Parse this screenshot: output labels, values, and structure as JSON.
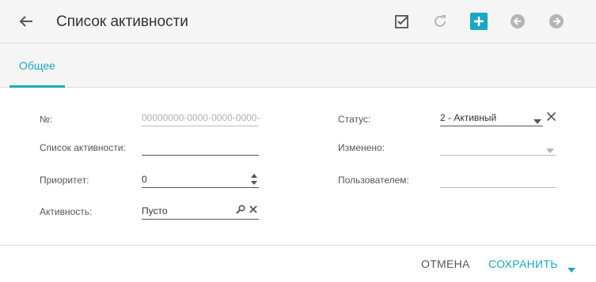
{
  "header": {
    "title": "Список активности"
  },
  "tabs": [
    {
      "label": "Общее"
    }
  ],
  "form": {
    "number": {
      "label": "№:",
      "placeholder": "00000000-0000-0000-0000-"
    },
    "activity_list": {
      "label": "Список активности:",
      "value": ""
    },
    "priority": {
      "label": "Приоритет:",
      "value": "0"
    },
    "activity": {
      "label": "Активность:",
      "value": "Пусто"
    },
    "status": {
      "label": "Статус:",
      "value": "2 - Активный"
    },
    "changed": {
      "label": "Изменено:",
      "value": ""
    },
    "by_user": {
      "label": "Пользователем:",
      "value": ""
    }
  },
  "footer": {
    "cancel_label": "ОТМЕНА",
    "save_label": "СОХРАНИТЬ"
  },
  "colors": {
    "accent": "#19a8c2",
    "header_bg": "#f5f5f5",
    "icon_gray": "#b5b5b5"
  }
}
